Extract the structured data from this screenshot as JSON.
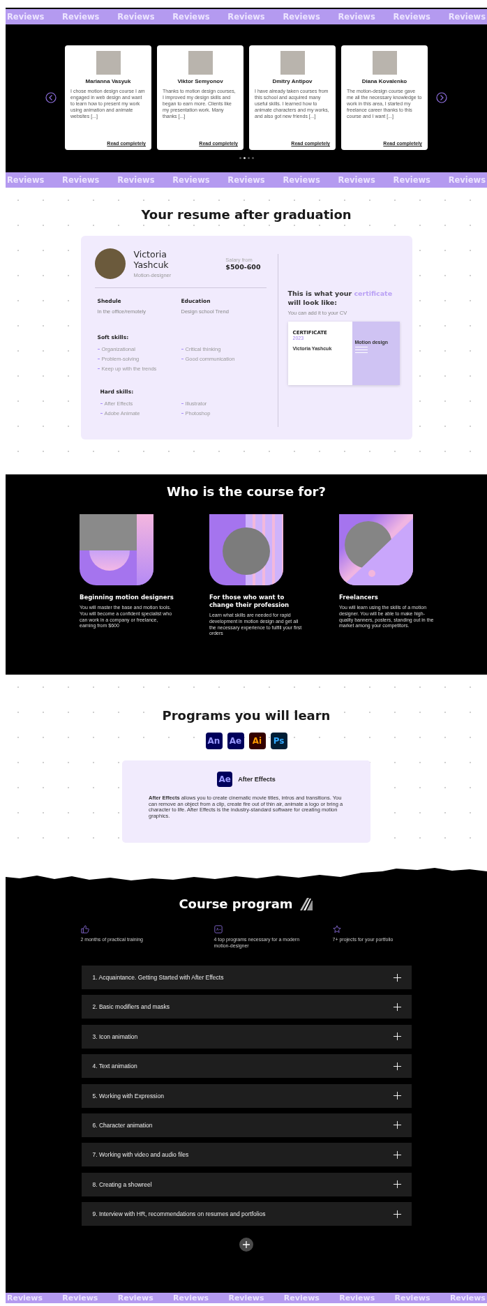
{
  "marquee_top": {
    "items": [
      "Reviews",
      "Reviews",
      "Reviews",
      "Reviews",
      "Reviews",
      "Reviews",
      "Reviews",
      "Reviews",
      "Reviews"
    ]
  },
  "reviews": {
    "cards": [
      {
        "name": "Marianna Vasyuk",
        "text": "I chose motion design course I am engaged in web design and want to learn how to present my work using animation and animate websites [...]",
        "link": "Read completely"
      },
      {
        "name": "Viktor Semyonov",
        "text": "Thanks to motion design courses, I improved my design skills and began to earn more. Clients like my presentation work. Many thanks [...]",
        "link": "Read completely"
      },
      {
        "name": "Dmitry Antipov",
        "text": "I have already taken courses from this school and acquired many useful skills. I learned how to animate characters and my works, and also got new friends [...]",
        "link": "Read completely"
      },
      {
        "name": "Diana Kovalenko",
        "text": "The motion-design course gave me all the necessary knowledge to work in this area, I started my freelance career thanks to this course and I want [...]",
        "link": "Read completely"
      }
    ],
    "dots": [
      {
        "selected": false
      },
      {
        "selected": true
      },
      {
        "selected": false
      },
      {
        "selected": false
      }
    ]
  },
  "marquee_middle": {
    "items": [
      "Reviews",
      "Reviews",
      "Reviews",
      "Reviews",
      "Reviews",
      "Reviews",
      "Reviews",
      "Reviews",
      "Reviews"
    ]
  },
  "resume": {
    "title": "Your resume after graduation",
    "profile": {
      "first_name": "Victoria",
      "last_name": "Yashcuk",
      "role": "Motion-designer",
      "salary_label": "Salary from",
      "salary": "$500-600"
    },
    "facts": [
      {
        "label": "Shedule",
        "value": "In the office/remotely"
      },
      {
        "label": "Education",
        "value": "Design school Trend"
      }
    ],
    "skill_groups": [
      {
        "title": "Soft skills:",
        "columns": [
          [
            "Organizational",
            "Problem-solving",
            "Keep up with the trends"
          ],
          [
            "Critical thinking",
            "Good communication"
          ]
        ]
      },
      {
        "title": "Hard skills:",
        "columns": [
          [
            "After Effects",
            "Adobe Animate"
          ],
          [
            "Illustrator",
            "Photoshop"
          ]
        ]
      }
    ],
    "certificate_heading": {
      "before": "This is what your",
      "highlight": "certificate",
      "after": "will look like:"
    },
    "certificate_note": "You can add it to your CV",
    "certificate": {
      "title": "CERTIFICATE",
      "year": "2023",
      "holder": "Victoria Yashcuk",
      "course": "Motion design"
    }
  },
  "audience": {
    "title": "Who is the course for?",
    "items": [
      {
        "kind": "corner",
        "title": "Beginning motion designers",
        "text": "You will master the base and motion tools. You will become a confident specialist who can work in a company or freelance, earning from $600"
      },
      {
        "kind": "circle",
        "title": "For those who want to change their profession",
        "text": "Learn what skills are needed for rapid development in motion design and get all the necessary experience to fulfill your first orders"
      },
      {
        "kind": "diagonal",
        "title": "Freelancers",
        "text": "You will learn using the skills of a motion designer. You will be able to make high-quality banners, posters, standing out in the market among your competitors."
      }
    ]
  },
  "programs": {
    "title": "Programs you will learn",
    "apps": [
      {
        "label": "An",
        "color": "#9999ff",
        "tile": {
          "color": "#00005b"
        }
      },
      {
        "label": "Ae",
        "color": "#9999ff",
        "tile": {
          "color": "#00005b"
        }
      },
      {
        "label": "Ai",
        "color": "#ff9a00",
        "tile": {
          "color": "#330000"
        }
      },
      {
        "label": "Ps",
        "color": "#31a8ff",
        "tile": {
          "color": "#001e36"
        }
      }
    ],
    "detail": {
      "icon": {
        "label": "Ae",
        "color": "#9999ff",
        "tile": {
          "color": "#00005b"
        }
      },
      "name": "After Effects",
      "text": "**After Effects** allows you to create cinematic movie titles, intros and transitions. You can remove an object from a clip, create fire out of thin air, animate a logo or bring a character to life. After Effects is the industry-standard software for creating motion graphics."
    }
  },
  "course_program": {
    "title": "Course program",
    "features": [
      {
        "kind": "thumb",
        "text": "2 months of practical training"
      },
      {
        "kind": "program",
        "text": "4 top programs necessary for a modern motion-designer"
      },
      {
        "kind": "star",
        "text": "7+ projects for your portfolio"
      }
    ],
    "modules": [
      {
        "label": "1. Acquaintance. Getting Started with After Effects",
        "expanded": false
      },
      {
        "label": "2. Basic modifiers and masks",
        "expanded": false
      },
      {
        "label": "3. Icon animation",
        "expanded": false
      },
      {
        "label": "4. Text animation",
        "expanded": false
      },
      {
        "label": "5. Working with Expression",
        "expanded": false
      },
      {
        "label": "6. Character animation",
        "expanded": false
      },
      {
        "label": "7. Working with video and audio files",
        "expanded": false
      },
      {
        "label": "8. Creating a showreel",
        "expanded": false
      },
      {
        "label": "9. Interview with HR, recommendations on resumes and portfolios",
        "expanded": false
      }
    ]
  },
  "marquee_bottom": {
    "items": [
      "Reviews",
      "Reviews",
      "Reviews",
      "Reviews",
      "Reviews",
      "Reviews",
      "Reviews",
      "Reviews",
      "Reviews"
    ]
  }
}
